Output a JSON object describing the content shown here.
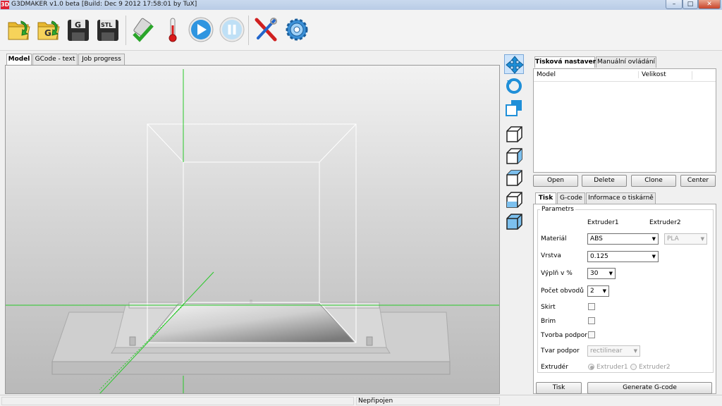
{
  "window": {
    "title": "G3DMAKER v1.0 beta [Build: Dec  9 2012 17:58:01 by TuX]",
    "app_icon_text": "3D",
    "minimize": "–",
    "maximize": "□",
    "close": "✕"
  },
  "toolbar": {
    "buttons": [
      {
        "name": "open-model-button",
        "icon": "folder-arrow-icon"
      },
      {
        "name": "open-gcode-button",
        "icon": "folder-gcode-icon",
        "text": "G"
      },
      {
        "name": "save-gcode-button",
        "icon": "floppy-g-icon",
        "text": "G"
      },
      {
        "name": "save-stl-button",
        "icon": "floppy-stl-icon",
        "text": "STL"
      },
      {
        "name": "connect-button",
        "icon": "connect-check-icon"
      },
      {
        "name": "temperature-button",
        "icon": "thermometer-icon"
      },
      {
        "name": "start-print-button",
        "icon": "play-icon"
      },
      {
        "name": "pause-button",
        "icon": "pause-icon"
      },
      {
        "name": "tools-button",
        "icon": "screwdriver-wrench-icon"
      },
      {
        "name": "settings-button",
        "icon": "gear-icon"
      }
    ]
  },
  "left_tabs": [
    "Model",
    "GCode - text",
    "Job progress"
  ],
  "right_tabs": [
    "Tisková nastavení",
    "Manuální ovládání"
  ],
  "model_table": {
    "columns": [
      "Model",
      "Velikost"
    ]
  },
  "model_buttons": [
    "Open",
    "Delete",
    "Clone",
    "Center"
  ],
  "print_tabs": [
    "Tisk",
    "G-code",
    "Informace o tiskárně"
  ],
  "params": {
    "group_title": "Parametrs",
    "extruder1": "Extruder1",
    "extruder2": "Extruder2",
    "material_label": "Materiál",
    "material_value_1": "ABS",
    "material_value_2": "PLA",
    "layer_label": "Vrstva",
    "layer_value": "0.125",
    "infill_label": "Výplň v %",
    "infill_value": "30",
    "perimeters_label": "Počet obvodů",
    "perimeters_value": "2",
    "skirt_label": "Skirt",
    "brim_label": "Brim",
    "support_label": "Tvorba podpor",
    "support_shape_label": "Tvar podpor",
    "support_shape_value": "rectilinear",
    "extruder_label": "Extrudér",
    "extruder_option_1": "Extruder1",
    "extruder_option_2": "Extruder2"
  },
  "actions": {
    "print": "Tisk",
    "generate": "Generate G-code"
  },
  "status": {
    "connection": "Nepřipojen"
  },
  "colors": {
    "axis_green": "#28c828",
    "accent_blue": "#1f8fd8"
  }
}
